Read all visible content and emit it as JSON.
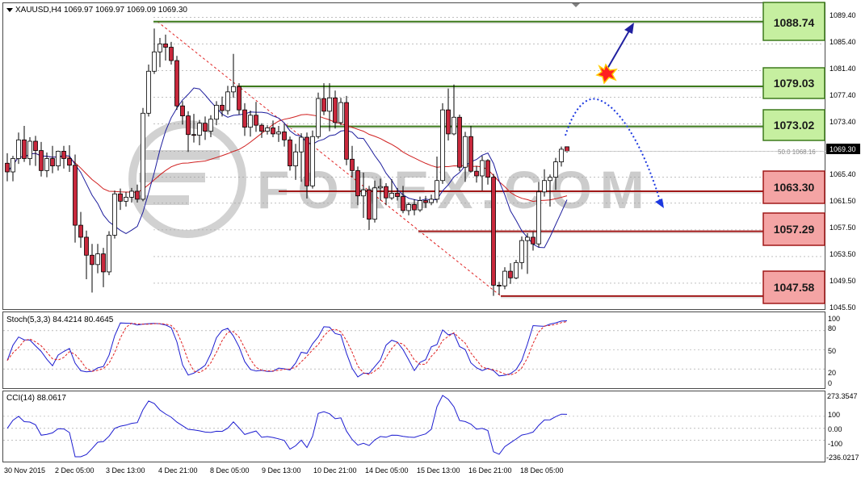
{
  "header": {
    "symbol_line": "XAUUSD,H4  1069.97 1069.97 1069.09 1069.30"
  },
  "watermark": {
    "text": "FOREX.COM"
  },
  "colors": {
    "bull_candle": "#ffffff",
    "bear_candle": "#c8283c",
    "candle_outline": "#000000",
    "ma_fast": "#1c1c9c",
    "ma_slow": "#d02020",
    "support_fill": "#f4a4a4",
    "support_line": "#a01818",
    "resistance_fill": "#c6efa0",
    "resistance_line": "#3d7a1c",
    "arrow_blue": "#2020a0",
    "stoch_main": "#1c1cd0",
    "stoch_signal": "#e02020",
    "cci_line": "#1c1cd0",
    "grid_dots": "#9a9a9a"
  },
  "price_axis": {
    "ticks": [
      "1089.40",
      "1085.40",
      "1081.40",
      "1077.40",
      "1073.40",
      "1069.30",
      "1065.40",
      "1061.50",
      "1057.50",
      "1053.50",
      "1049.50",
      "1045.50"
    ],
    "current_price": "1069.30",
    "fib_label": "50.0  1068.16"
  },
  "levels": {
    "resistance": [
      {
        "label": "1088.74",
        "price": 1088.74
      },
      {
        "label": "1079.03",
        "price": 1079.03
      },
      {
        "label": "1073.02",
        "price": 1073.02
      }
    ],
    "support": [
      {
        "label": "1063.30",
        "price": 1063.3
      },
      {
        "label": "1057.29",
        "price": 1057.29
      },
      {
        "label": "1047.58",
        "price": 1047.58
      }
    ]
  },
  "stoch_panel": {
    "title": "Stoch(5,3,3) 84.4214 80.4645",
    "ticks": [
      "100",
      "80",
      "50",
      "20",
      "0"
    ]
  },
  "cci_panel": {
    "title": "CCI(14) 88.0617",
    "ticks": [
      "273.3547",
      "100",
      "0.00",
      "-100",
      "-236.0217"
    ]
  },
  "time_axis": {
    "labels": [
      "30 Nov 2015",
      "2 Dec 05:00",
      "3 Dec 13:00",
      "4 Dec 21:00",
      "8 Dec 05:00",
      "9 Dec 13:00",
      "10 Dec 21:00",
      "14 Dec 05:00",
      "15 Dec 13:00",
      "16 Dec 21:00",
      "18 Dec 05:00"
    ]
  },
  "chart_data": {
    "type": "candlestick",
    "symbol": "XAUUSD",
    "timeframe": "H4",
    "ylim": [
      1045.5,
      1091.5
    ],
    "candles": [
      [
        1067.5,
        1069.0,
        1064.8,
        1066.2
      ],
      [
        1066.2,
        1068.6,
        1064.8,
        1068.2
      ],
      [
        1068.2,
        1072.1,
        1067.4,
        1071.0
      ],
      [
        1071.0,
        1073.1,
        1067.7,
        1068.2
      ],
      [
        1068.2,
        1071.4,
        1067.2,
        1070.8
      ],
      [
        1070.8,
        1071.6,
        1067.1,
        1069.4
      ],
      [
        1069.4,
        1070.7,
        1065.5,
        1066.4
      ],
      [
        1066.4,
        1069.1,
        1065.4,
        1068.2
      ],
      [
        1068.2,
        1070.1,
        1066.0,
        1067.1
      ],
      [
        1067.1,
        1069.4,
        1066.4,
        1069.3
      ],
      [
        1069.3,
        1070.1,
        1066.7,
        1068.2
      ],
      [
        1068.2,
        1070.2,
        1066.2,
        1067.2
      ],
      [
        1067.2,
        1068.8,
        1055.6,
        1058.2
      ],
      [
        1058.2,
        1060.2,
        1054.8,
        1056.4
      ],
      [
        1056.4,
        1057.4,
        1050.1,
        1053.7
      ],
      [
        1053.7,
        1055.4,
        1048.1,
        1052.3
      ],
      [
        1052.3,
        1055.4,
        1051.0,
        1053.9
      ],
      [
        1053.9,
        1054.8,
        1048.9,
        1051.2
      ],
      [
        1051.2,
        1057.3,
        1050.7,
        1056.7
      ],
      [
        1056.7,
        1063.4,
        1056.2,
        1062.9
      ],
      [
        1062.9,
        1063.7,
        1060.5,
        1061.8
      ],
      [
        1061.8,
        1063.2,
        1061.0,
        1062.4
      ],
      [
        1062.4,
        1063.8,
        1061.6,
        1063.3
      ],
      [
        1063.3,
        1064.3,
        1061.6,
        1062.1
      ],
      [
        1062.1,
        1075.8,
        1061.8,
        1075.0
      ],
      [
        1075.0,
        1082.3,
        1074.5,
        1081.3
      ],
      [
        1081.3,
        1087.7,
        1080.9,
        1084.2
      ],
      [
        1084.2,
        1086.3,
        1081.9,
        1085.4
      ],
      [
        1085.4,
        1086.8,
        1082.9,
        1084.9
      ],
      [
        1084.9,
        1085.7,
        1082.3,
        1082.9
      ],
      [
        1082.9,
        1083.6,
        1075.5,
        1076.1
      ],
      [
        1076.1,
        1076.8,
        1073.3,
        1074.6
      ],
      [
        1074.6,
        1075.3,
        1069.2,
        1071.8
      ],
      [
        1071.8,
        1074.9,
        1070.6,
        1071.7
      ],
      [
        1071.7,
        1074.0,
        1070.2,
        1073.5
      ],
      [
        1073.5,
        1074.5,
        1071.0,
        1072.3
      ],
      [
        1072.3,
        1074.7,
        1071.4,
        1074.1
      ],
      [
        1074.1,
        1076.8,
        1073.2,
        1076.2
      ],
      [
        1076.2,
        1077.5,
        1074.5,
        1075.4
      ],
      [
        1075.4,
        1079.1,
        1074.8,
        1078.2
      ],
      [
        1078.2,
        1083.9,
        1077.3,
        1079.0
      ],
      [
        1079.0,
        1079.5,
        1074.8,
        1075.5
      ],
      [
        1075.5,
        1076.5,
        1071.6,
        1072.9
      ],
      [
        1072.9,
        1075.4,
        1071.5,
        1074.7
      ],
      [
        1074.7,
        1076.7,
        1072.2,
        1073.2
      ],
      [
        1073.2,
        1073.5,
        1071.3,
        1072.3
      ],
      [
        1072.3,
        1073.2,
        1071.8,
        1072.8
      ],
      [
        1072.8,
        1073.9,
        1071.4,
        1071.9
      ],
      [
        1071.9,
        1073.1,
        1070.7,
        1072.2
      ],
      [
        1072.2,
        1073.4,
        1070.0,
        1071.0
      ],
      [
        1071.0,
        1071.5,
        1066.4,
        1067.1
      ],
      [
        1067.1,
        1070.4,
        1065.0,
        1069.2
      ],
      [
        1069.2,
        1072.0,
        1064.7,
        1071.4
      ],
      [
        1071.4,
        1072.1,
        1062.2,
        1064.1
      ],
      [
        1064.1,
        1072.4,
        1063.7,
        1071.5
      ],
      [
        1071.5,
        1078.1,
        1071.2,
        1077.2
      ],
      [
        1077.2,
        1079.5,
        1074.7,
        1075.3
      ],
      [
        1075.3,
        1079.5,
        1072.3,
        1077.3
      ],
      [
        1077.3,
        1078.4,
        1072.7,
        1073.6
      ],
      [
        1073.6,
        1077.3,
        1073.2,
        1076.6
      ],
      [
        1076.6,
        1077.6,
        1067.2,
        1068.1
      ],
      [
        1068.1,
        1070.1,
        1065.4,
        1066.4
      ],
      [
        1066.4,
        1067.0,
        1061.2,
        1062.6
      ],
      [
        1062.6,
        1066.1,
        1059.3,
        1063.5
      ],
      [
        1063.5,
        1064.1,
        1057.5,
        1059.1
      ],
      [
        1059.1,
        1064.9,
        1058.6,
        1063.8
      ],
      [
        1063.8,
        1065.2,
        1061.9,
        1064.0
      ],
      [
        1064.0,
        1064.5,
        1061.2,
        1062.3
      ],
      [
        1062.3,
        1065.1,
        1062.0,
        1063.0
      ],
      [
        1063.0,
        1063.8,
        1061.9,
        1062.5
      ],
      [
        1062.5,
        1064.1,
        1060.0,
        1060.4
      ],
      [
        1060.4,
        1061.6,
        1059.7,
        1061.3
      ],
      [
        1061.3,
        1062.1,
        1059.7,
        1060.5
      ],
      [
        1060.5,
        1062.5,
        1060.2,
        1061.9
      ],
      [
        1061.9,
        1062.6,
        1060.8,
        1061.6
      ],
      [
        1061.6,
        1062.8,
        1061.2,
        1062.1
      ],
      [
        1062.1,
        1068.5,
        1061.6,
        1064.9
      ],
      [
        1064.9,
        1076.5,
        1064.4,
        1075.5
      ],
      [
        1075.5,
        1078.7,
        1070.9,
        1071.9
      ],
      [
        1071.9,
        1079.3,
        1071.7,
        1074.4
      ],
      [
        1074.4,
        1074.8,
        1066.3,
        1066.9
      ],
      [
        1066.9,
        1072.2,
        1064.7,
        1071.5
      ],
      [
        1071.5,
        1073.1,
        1066.1,
        1066.3
      ],
      [
        1066.3,
        1067.1,
        1064.6,
        1065.6
      ],
      [
        1065.6,
        1068.6,
        1063.4,
        1067.9
      ],
      [
        1067.9,
        1068.1,
        1064.3,
        1065.4
      ],
      [
        1065.4,
        1065.9,
        1047.6,
        1049.2
      ],
      [
        1049.2,
        1049.7,
        1047.8,
        1049.1
      ],
      [
        1049.1,
        1051.9,
        1048.6,
        1051.3
      ],
      [
        1051.3,
        1052.5,
        1049.4,
        1050.3
      ],
      [
        1050.3,
        1053.0,
        1050.1,
        1052.6
      ],
      [
        1052.6,
        1056.5,
        1051.6,
        1055.9
      ],
      [
        1055.9,
        1057.0,
        1050.9,
        1056.4
      ],
      [
        1056.4,
        1057.2,
        1054.4,
        1055.4
      ],
      [
        1055.4,
        1064.7,
        1054.9,
        1063.2
      ],
      [
        1063.2,
        1066.6,
        1062.5,
        1064.9
      ],
      [
        1064.9,
        1065.8,
        1061.0,
        1065.4
      ],
      [
        1065.4,
        1068.3,
        1063.5,
        1067.7
      ],
      [
        1067.7,
        1070.0,
        1067.0,
        1069.6
      ],
      [
        1069.97,
        1069.97,
        1069.09,
        1069.3
      ]
    ]
  },
  "annotations": {
    "explosion_label": "explosion"
  }
}
